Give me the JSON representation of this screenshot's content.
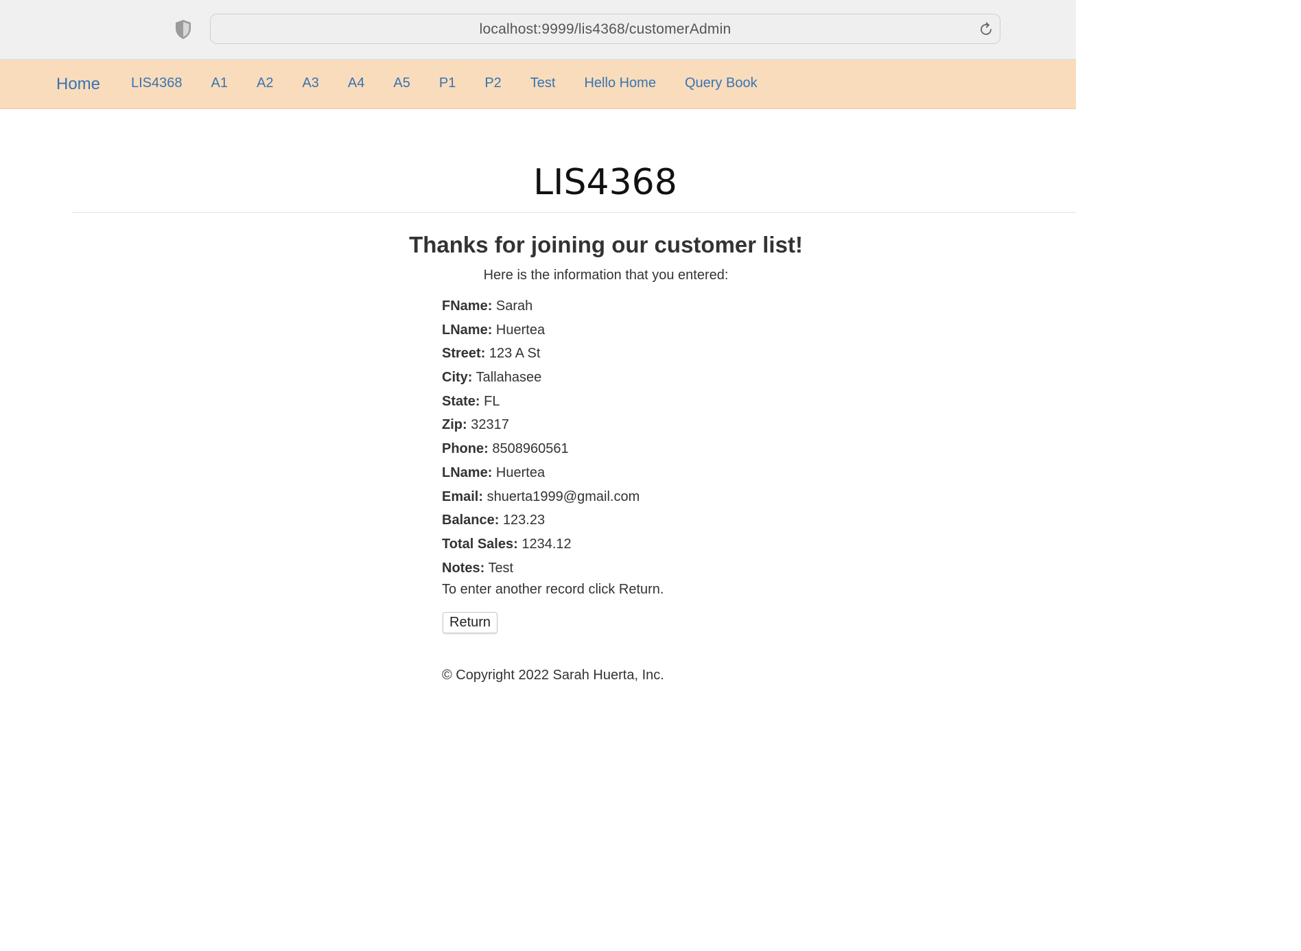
{
  "browser": {
    "url": "localhost:9999/lis4368/customerAdmin",
    "shield_icon": "shield-icon",
    "reload_icon": "reload-icon"
  },
  "navbar": {
    "brand": "Home",
    "items": [
      "LIS4368",
      "A1",
      "A2",
      "A3",
      "A4",
      "A5",
      "P1",
      "P2",
      "Test",
      "Hello Home",
      "Query Book"
    ],
    "background": "#f8dcbc",
    "link_color": "#3a73b0"
  },
  "main": {
    "heading": "LIS4368",
    "thanks": "Thanks for joining our customer list!",
    "subtitle": "Here is the information that you entered:",
    "fields": [
      {
        "label": "FName:",
        "value": "Sarah"
      },
      {
        "label": "LName:",
        "value": "Huertea"
      },
      {
        "label": "Street:",
        "value": "123 A St"
      },
      {
        "label": "City:",
        "value": "Tallahasee"
      },
      {
        "label": "State:",
        "value": "FL"
      },
      {
        "label": "Zip:",
        "value": "32317"
      },
      {
        "label": "Phone:",
        "value": "8508960561"
      },
      {
        "label": "LName:",
        "value": "Huertea"
      },
      {
        "label": "Email:",
        "value": "shuerta1999@gmail.com"
      },
      {
        "label": "Balance:",
        "value": "123.23"
      },
      {
        "label": "Total Sales:",
        "value": "1234.12"
      },
      {
        "label": "Notes:",
        "value": "Test"
      }
    ],
    "instruction": "To enter another record click Return.",
    "return_button": "Return"
  },
  "footer": {
    "copyright": "© Copyright 2022 Sarah Huerta, Inc."
  }
}
